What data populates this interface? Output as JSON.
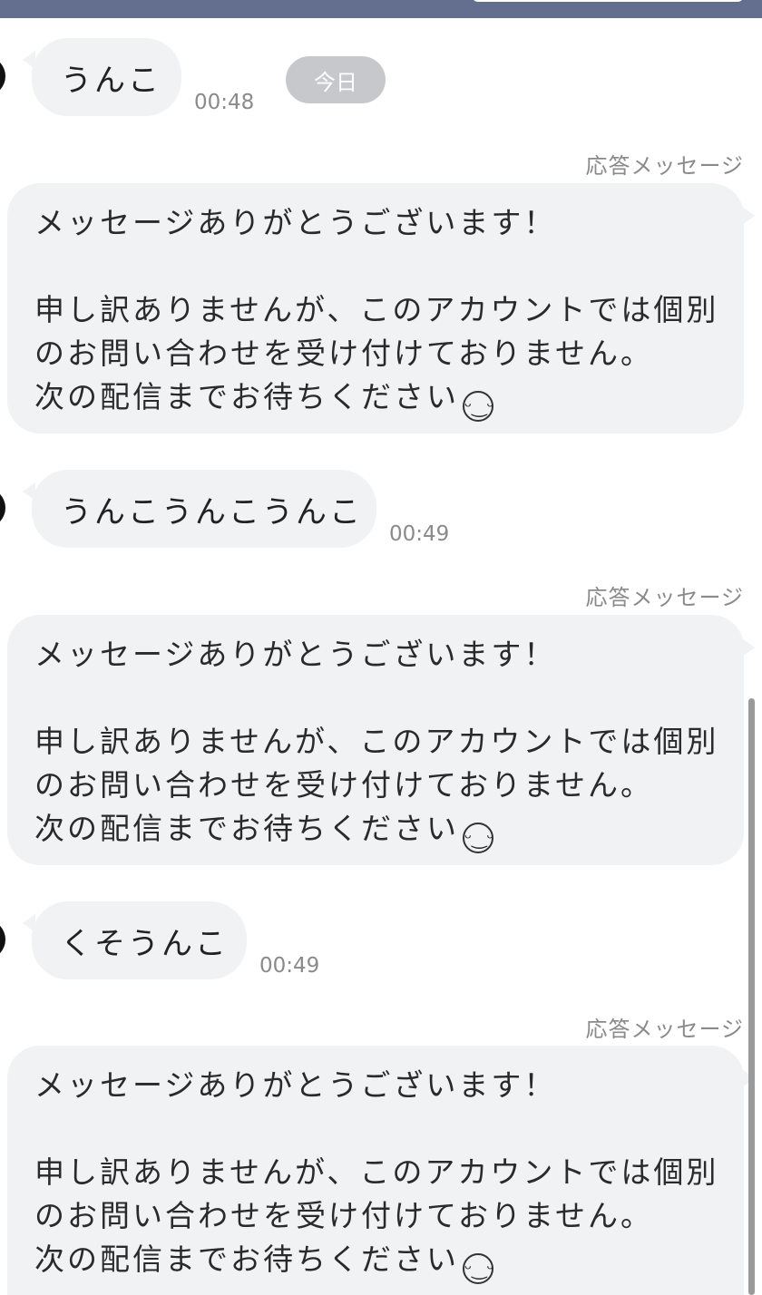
{
  "date_chip": "今日",
  "auto_reply_label": "応答メッセージ",
  "messages": [
    {
      "text": "うんこ",
      "time": "00:48"
    },
    {
      "text": "うんこうんこうんこ",
      "time": "00:49"
    },
    {
      "text": "くそうんこ",
      "time": "00:49"
    }
  ],
  "auto_reply": {
    "line1": "メッセージありがとうございます！",
    "line2": "申し訳ありませんが、このアカウントでは個別",
    "line3": "のお問い合わせを受け付けておりません。",
    "line4": "次の配信までお待ちください",
    "emoji": "smiling-face-emoji"
  }
}
